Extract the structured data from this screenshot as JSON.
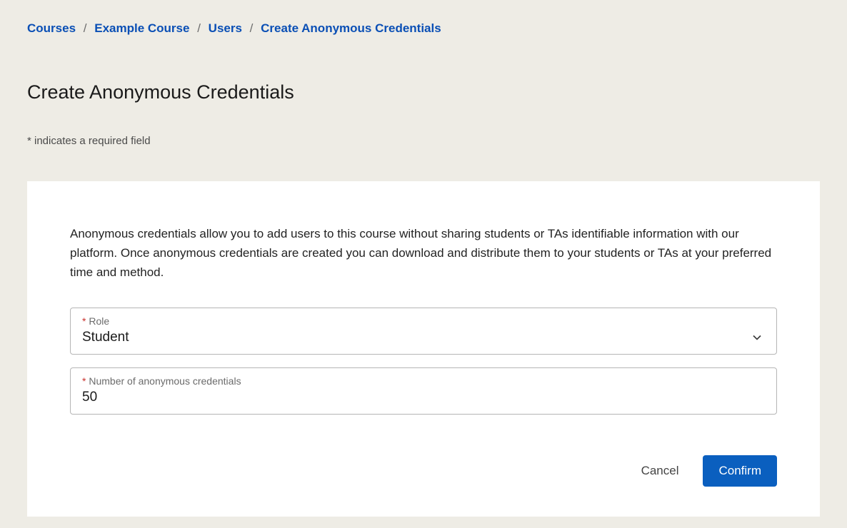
{
  "breadcrumb": {
    "items": [
      {
        "label": "Courses"
      },
      {
        "label": "Example Course"
      },
      {
        "label": "Users"
      },
      {
        "label": "Create Anonymous Credentials"
      }
    ],
    "separator": "/"
  },
  "page_title": "Create Anonymous Credentials",
  "required_note": "* indicates a required field",
  "form": {
    "description": "Anonymous credentials allow you to add users to this course without sharing students or TAs identifiable information with our platform. Once anonymous credentials are created you can download and distribute them to your students or TAs at your preferred time and method.",
    "fields": {
      "role": {
        "required_mark": "*",
        "label": "Role",
        "value": "Student"
      },
      "count": {
        "required_mark": "*",
        "label": "Number of anonymous credentials",
        "value": "50"
      }
    },
    "buttons": {
      "cancel": "Cancel",
      "confirm": "Confirm"
    }
  }
}
